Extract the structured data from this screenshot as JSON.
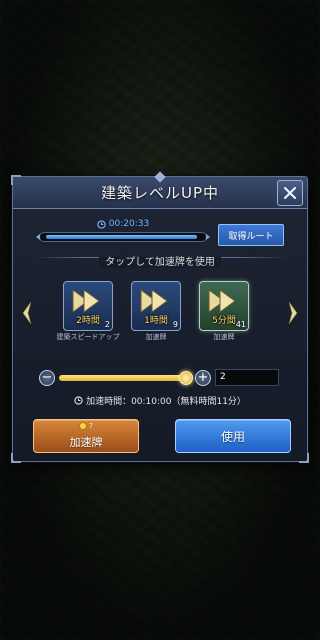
{
  "dialog": {
    "title": "建築レベルUP中",
    "timer": "00:20:33",
    "progress_fraction": 0.97,
    "route_button": "取得ルート",
    "instruction": "タップして加速牌を使用"
  },
  "items": [
    {
      "time_label": "2時間",
      "count": "2",
      "name": "建築スピードアップ",
      "style": "blue"
    },
    {
      "time_label": "1時間",
      "count": "9",
      "name": "加速牌",
      "style": "blue"
    },
    {
      "time_label": "5分間",
      "count": "41",
      "name": "加速牌",
      "style": "green"
    }
  ],
  "slider": {
    "fraction": 0.96,
    "quantity": "2"
  },
  "accel_time": "加速時間：00:10:00（無料時間11分）",
  "buttons": {
    "gold_cost": "7",
    "gold_label": "加速牌",
    "use_label": "使用"
  },
  "icons": {
    "close": "close-icon",
    "clock": "clock-icon",
    "nav_left": "chevron-left-icon",
    "nav_right": "chevron-right-icon",
    "coin": "coin-icon"
  },
  "colors": {
    "accent_blue": "#3f7ad6",
    "gold": "#ffd86b",
    "timer_blue": "#6fb4ff"
  }
}
